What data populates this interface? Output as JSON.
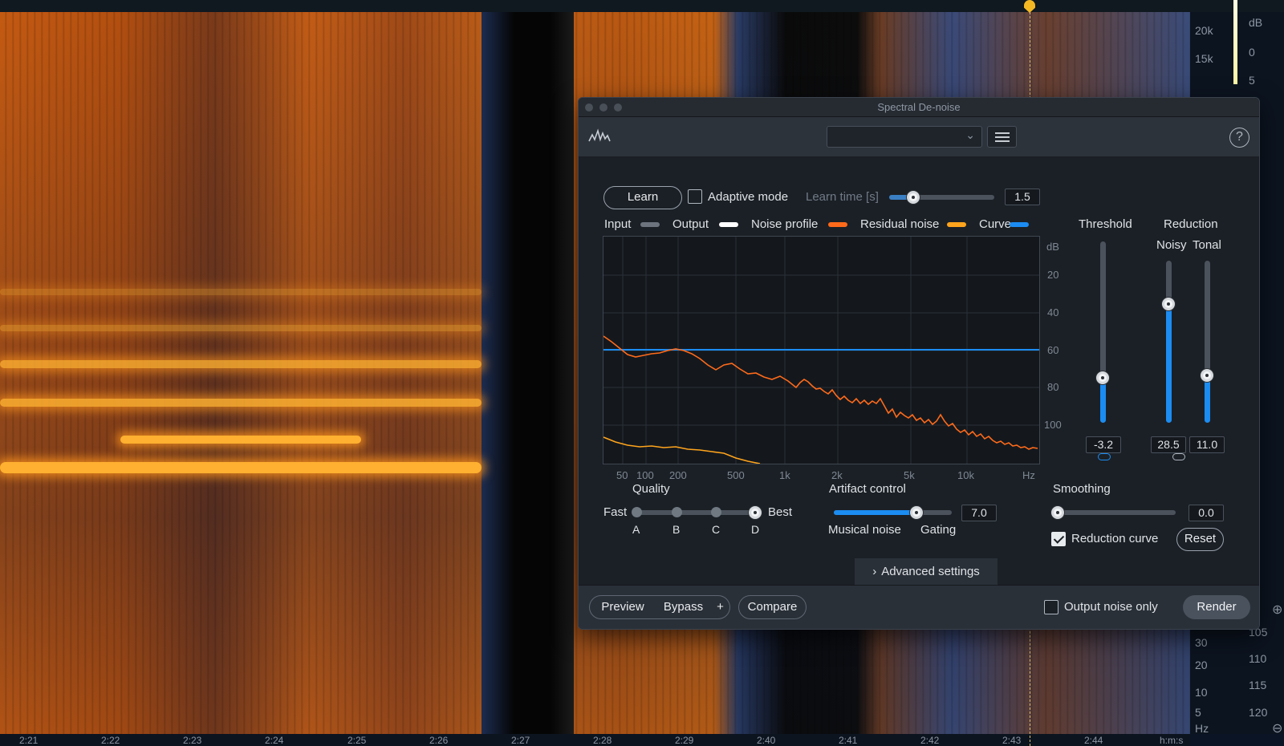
{
  "dialog": {
    "title": "Spectral De-noise",
    "preset_value": "",
    "help_label": "?"
  },
  "learn": {
    "button_label": "Learn",
    "adaptive_label": "Adaptive mode",
    "adaptive_checked": false,
    "learn_time_label": "Learn time [s]",
    "learn_time_value": "1.5"
  },
  "legend": [
    {
      "label": "Input",
      "color": "#6d747e"
    },
    {
      "label": "Output",
      "color": "#ffffff"
    },
    {
      "label": "Noise profile",
      "color": "#ff6a1a"
    },
    {
      "label": "Residual noise",
      "color": "#ffa41c"
    },
    {
      "label": "Curve",
      "color": "#1b8cf2"
    }
  ],
  "graph": {
    "db_unit": "dB",
    "db_ticks": [
      "20",
      "40",
      "60",
      "80",
      "100"
    ],
    "hz_unit": "Hz",
    "hz_ticks": [
      "50",
      "100",
      "200",
      "500",
      "1k",
      "2k",
      "5k",
      "10k"
    ]
  },
  "threshold": {
    "title": "Threshold",
    "value": "-3.2"
  },
  "reduction": {
    "title": "Reduction",
    "noisy_label": "Noisy",
    "tonal_label": "Tonal",
    "noisy_value": "28.5",
    "tonal_value": "11.0"
  },
  "quality": {
    "title": "Quality",
    "fast_label": "Fast",
    "best_label": "Best",
    "options": [
      "A",
      "B",
      "C",
      "D"
    ],
    "selected": "D"
  },
  "artifact": {
    "title": "Artifact control",
    "value": "7.0",
    "left_label": "Musical noise",
    "right_label": "Gating"
  },
  "smoothing": {
    "title": "Smoothing",
    "value": "0.0"
  },
  "reduction_curve": {
    "label": "Reduction curve",
    "checked": true,
    "reset_label": "Reset"
  },
  "advanced_label": "Advanced settings",
  "footer": {
    "preview_label": "Preview",
    "bypass_label": "Bypass",
    "plus_label": "+",
    "compare_label": "Compare",
    "output_noise_label": "Output noise only",
    "output_noise_checked": false,
    "render_label": "Render"
  },
  "spectrogram": {
    "freq_ticks": [
      "20k",
      "15k",
      "30",
      "20",
      "10",
      "5",
      "Hz"
    ],
    "db_header": "dB",
    "db_ticks": [
      "0",
      "5",
      "105",
      "110",
      "115",
      "120"
    ],
    "time_ticks": [
      "2:21",
      "2:22",
      "2:23",
      "2:24",
      "2:25",
      "2:26",
      "2:27",
      "2:28",
      "2:29",
      "2:40",
      "2:41",
      "2:42",
      "2:43",
      "2:44",
      "h:m:s"
    ]
  }
}
